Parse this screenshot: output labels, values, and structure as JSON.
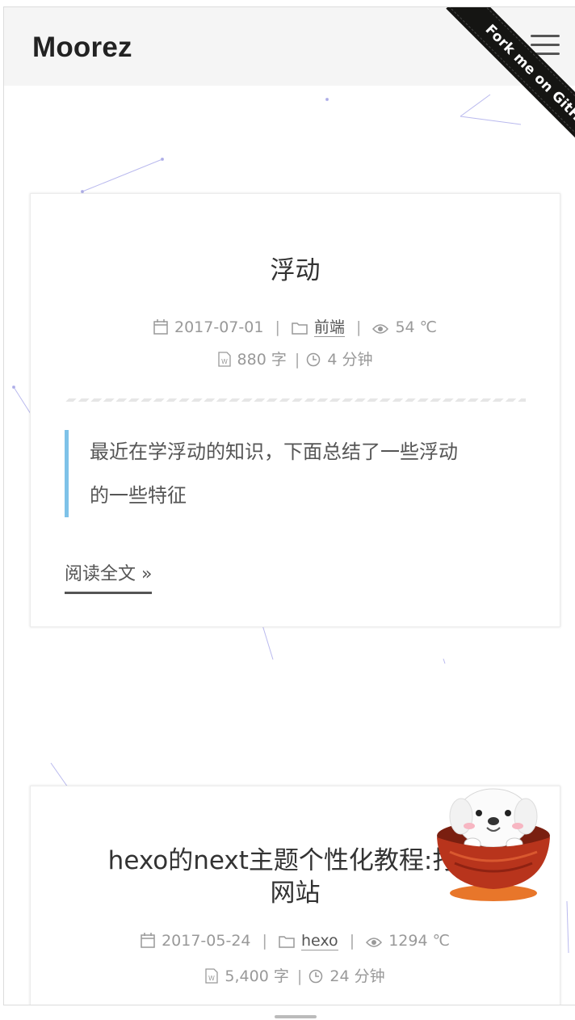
{
  "header": {
    "brand": "Moorez",
    "ribbon_text": "Fork me on GitHub"
  },
  "posts": [
    {
      "title": "浮动",
      "date": "2017-07-01",
      "category": "前端",
      "views": "54 ℃",
      "words": "880 字",
      "reading_time": "4 分钟",
      "excerpt_line1": "最近在学浮动的知识，下面总结了一些浮动",
      "excerpt_line2": "的一些特征",
      "read_more": "阅读全文 »"
    },
    {
      "title_line1": "hexo的next主题个性化教程:打造",
      "title_line2": "网站",
      "date": "2017-05-24",
      "category": "hexo",
      "views": "1294 ℃",
      "words": "5,400 字",
      "reading_time": "24 分钟"
    }
  ],
  "colors": {
    "accent_quote": "#7ec2e8",
    "brand_text": "#222222",
    "header_bg": "#f5f5f5",
    "ribbon_bg": "#151513"
  },
  "icons": [
    "calendar-icon",
    "folder-icon",
    "eye-icon",
    "file-word-icon",
    "clock-icon",
    "menu-icon"
  ]
}
